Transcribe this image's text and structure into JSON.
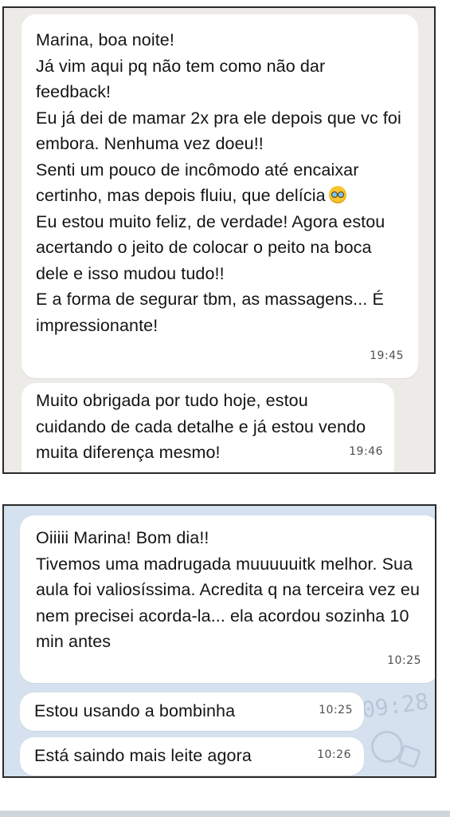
{
  "chat1": {
    "messages": [
      {
        "text": "Marina, boa noite!\nJá vim aqui pq não tem como não dar feedback!\nEu já dei de mamar 2x pra ele depois que vc foi embora. Nenhuma vez doeu!!\nSenti um pouco de incômodo até encaixar certinho, mas depois fluiu, que delícia",
        "emoji": "pleading-face-emoji",
        "text2": "Eu estou muito feliz, de verdade! Agora estou acertando o jeito de colocar o peito na boca dele e isso mudou tudo!!\nE a forma de segurar tbm, as massagens... É impressionante!",
        "time": "19:45"
      },
      {
        "text": "Muito obrigada por tudo hoje, estou cuidando de cada detalhe e já estou vendo muita diferença mesmo!",
        "time": "19:46"
      }
    ]
  },
  "chat2": {
    "messages": [
      {
        "text": "Oiiiii Marina! Bom dia!!\nTivemos uma madrugada muuuuuitk melhor. Sua aula foi valiosíssima. Acredita q na terceira vez eu nem precisei acorda-la... ela acordou sozinha 10 min antes",
        "time": "10:25"
      },
      {
        "text": "Estou usando a bombinha",
        "time": "10:25"
      },
      {
        "text": "Está saindo mais leite agora",
        "time": "10:26"
      }
    ],
    "wallpaper_text": "09:28"
  },
  "colors": {
    "panel1_bg": "#ecebe8",
    "panel2_bg": "#d5e1ee",
    "bubble": "#ffffff"
  }
}
